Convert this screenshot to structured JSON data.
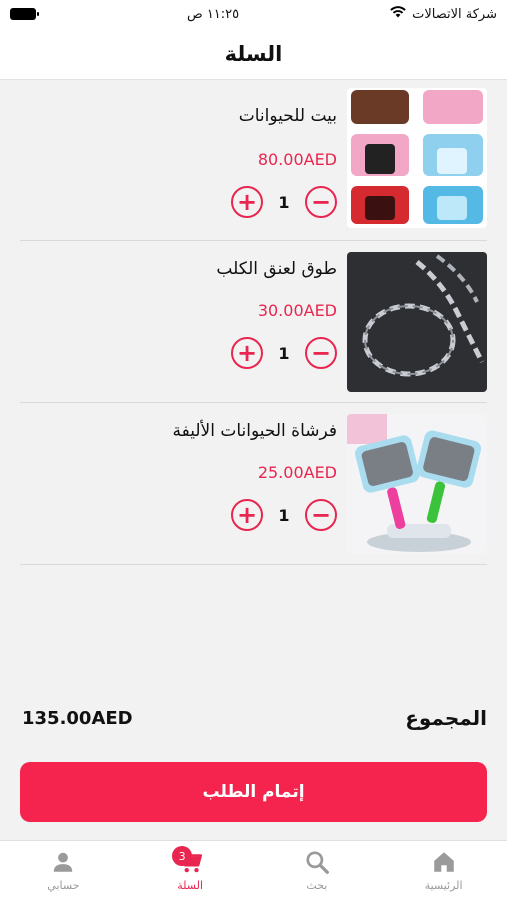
{
  "status_bar": {
    "carrier": "شركة الاتصالات",
    "time": "١١:٢٥ ص"
  },
  "header": {
    "title": "السلة"
  },
  "cart": {
    "items": [
      {
        "name": "بيت للحيوانات",
        "price": "80.00AED",
        "quantity": "1",
        "image": "pet-playpen-image"
      },
      {
        "name": "طوق لعنق الكلب",
        "price": "30.00AED",
        "quantity": "1",
        "image": "chain-collar-image"
      },
      {
        "name": "فرشاة الحيوانات الأليفة",
        "price": "25.00AED",
        "quantity": "1",
        "image": "pet-brush-image"
      }
    ]
  },
  "summary": {
    "total_label": "المجموع",
    "total_value": "135.00AED"
  },
  "checkout": {
    "label": "إتمام الطلب"
  },
  "tab_bar": {
    "tabs": [
      {
        "label": "الرئيسية",
        "icon": "home-icon"
      },
      {
        "label": "بحث",
        "icon": "search-icon"
      },
      {
        "label": "السلة",
        "icon": "cart-icon",
        "badge": "3",
        "active": true
      },
      {
        "label": "حسابي",
        "icon": "user-icon"
      }
    ]
  },
  "colors": {
    "accent": "#e8264f",
    "button": "#f5244e"
  }
}
